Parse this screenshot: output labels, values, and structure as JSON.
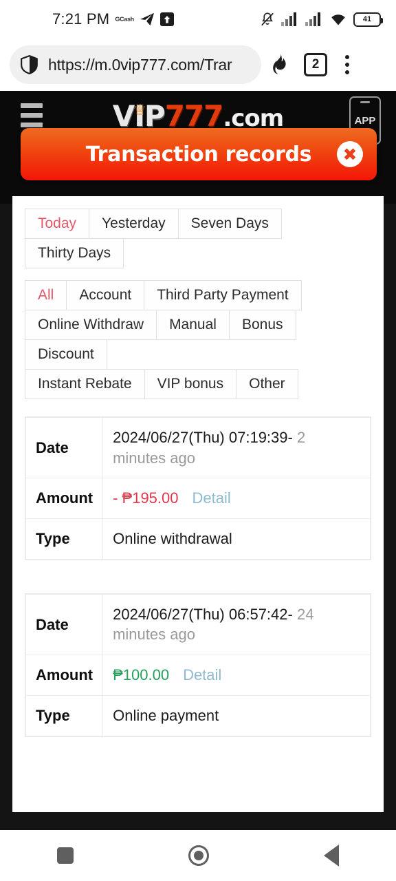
{
  "status_bar": {
    "time": "7:21 PM",
    "app_label": "GCash",
    "icons": [
      "telegram-icon",
      "upload-box-icon",
      "bell-muted-icon",
      "signal-bars-icon",
      "signal-bars-icon",
      "wifi-icon"
    ],
    "battery_level": "41"
  },
  "browser_bar": {
    "url": "https://m.0vip777.com/Trar",
    "shield_icon": "shield-icon",
    "flame_icon": "flame-icon",
    "tab_count": "2",
    "menu_icon": "kebab-menu-icon"
  },
  "site_header": {
    "menu_icon": "hamburger-icon",
    "logo": {
      "part1": "VIP",
      "part2": "777",
      "part3": ".com",
      "crown_icon": "crown-icon"
    },
    "app_button_label": "APP"
  },
  "banner": {
    "title": "Transaction records",
    "close_label": "✖",
    "close_icon": "close-circle-icon",
    "gradient_top": "#ef6a21",
    "gradient_bottom": "#f41508"
  },
  "filters": {
    "date_range": [
      {
        "label": "Today",
        "active": true
      },
      {
        "label": "Yesterday",
        "active": false
      },
      {
        "label": "Seven Days",
        "active": false
      },
      {
        "label": "Thirty Days",
        "active": false
      }
    ],
    "types_row1": [
      {
        "label": "All",
        "active": true
      },
      {
        "label": "Account",
        "active": false
      },
      {
        "label": "Third Party Payment",
        "active": false
      }
    ],
    "types_row2": [
      {
        "label": "Online Withdraw",
        "active": false
      },
      {
        "label": "Manual",
        "active": false
      },
      {
        "label": "Bonus",
        "active": false
      },
      {
        "label": "Discount",
        "active": false
      }
    ],
    "types_row3": [
      {
        "label": "Instant Rebate",
        "active": false
      },
      {
        "label": "VIP bonus",
        "active": false
      },
      {
        "label": "Other",
        "active": false
      }
    ],
    "active_color": "#e3596b"
  },
  "records": {
    "labels": {
      "date": "Date",
      "amount": "Amount",
      "type": "Type"
    },
    "detail_link": "Detail",
    "items": [
      {
        "date": "2024/06/27(Thu) 07:19:39-",
        "relative": " 2 minutes ago",
        "amount": "- ₱195.00",
        "amount_sign": "negative",
        "amount_color": "#e0384a",
        "type": "Online withdrawal"
      },
      {
        "date": "2024/06/27(Thu) 06:57:42-",
        "relative": " 24 minutes ago",
        "amount": "₱100.00",
        "amount_sign": "positive",
        "amount_color": "#23a05a",
        "type": "Online payment"
      }
    ]
  },
  "nav_bar": {
    "recents_icon": "square-recents-icon",
    "home_icon": "circle-home-icon",
    "back_icon": "triangle-back-icon"
  }
}
